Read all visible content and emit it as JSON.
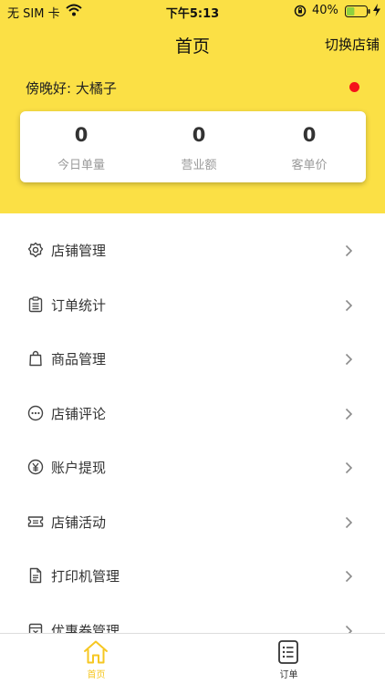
{
  "status_bar": {
    "carrier": "无 SIM 卡",
    "time": "下午5:13",
    "battery_percent": "40%",
    "battery_level": 0.4
  },
  "nav": {
    "title": "首页",
    "switch_store": "切换店铺"
  },
  "greeting": "傍晚好: 大橘子",
  "stats": [
    {
      "value": "0",
      "label": "今日单量"
    },
    {
      "value": "0",
      "label": "营业额"
    },
    {
      "value": "0",
      "label": "客单价"
    }
  ],
  "menu": [
    {
      "label": "店铺管理",
      "icon": "store-settings-icon"
    },
    {
      "label": "订单统计",
      "icon": "clipboard-icon"
    },
    {
      "label": "商品管理",
      "icon": "shopping-bag-icon"
    },
    {
      "label": "店铺评论",
      "icon": "comment-icon"
    },
    {
      "label": "账户提现",
      "icon": "yuan-icon"
    },
    {
      "label": "店铺活动",
      "icon": "ticket-icon"
    },
    {
      "label": "打印机管理",
      "icon": "document-icon"
    },
    {
      "label": "优惠券管理",
      "icon": "coupon-box-icon"
    }
  ],
  "tabs": [
    {
      "label": "首页",
      "icon": "home-icon",
      "active": true
    },
    {
      "label": "订单",
      "icon": "order-list-icon",
      "active": false
    }
  ],
  "colors": {
    "header_bg": "#fbe045",
    "accent": "#f6c722",
    "notification_dot": "#f5121a",
    "battery_fill": "#8fd13f"
  }
}
